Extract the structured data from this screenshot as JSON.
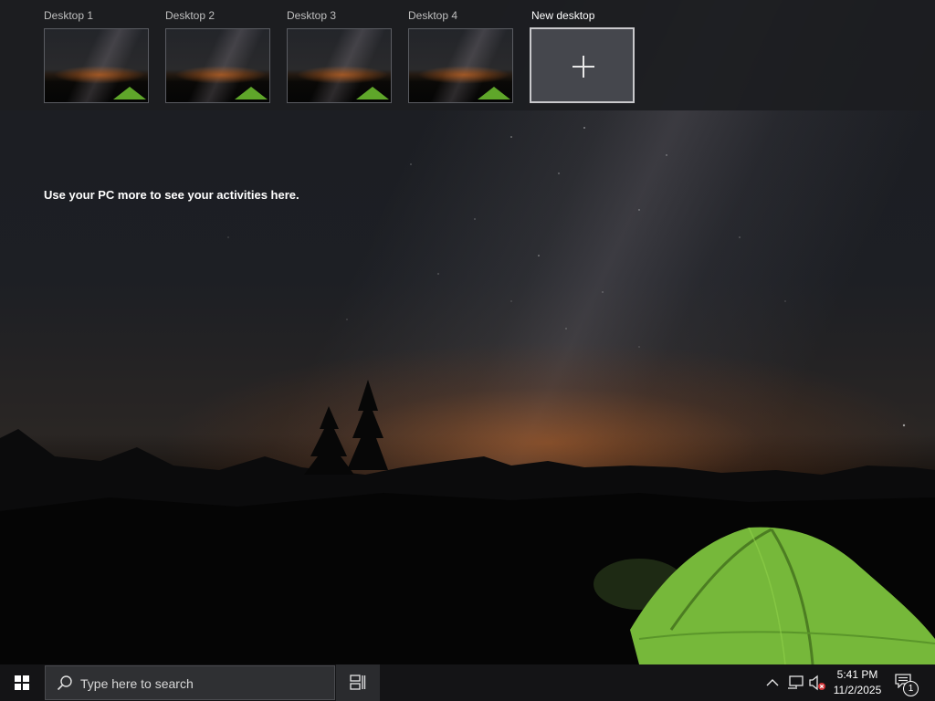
{
  "task_view": {
    "desktops": [
      {
        "label": "Desktop 1"
      },
      {
        "label": "Desktop 2"
      },
      {
        "label": "Desktop 3"
      },
      {
        "label": "Desktop 4"
      }
    ],
    "new_desktop_label": "New desktop",
    "activities_message": "Use your PC more to see your activities here."
  },
  "taskbar": {
    "search_placeholder": "Type here to search",
    "clock": {
      "time": "5:41 PM",
      "date": "11/2/2025"
    },
    "notification_count": "1",
    "icons": {
      "start": "windows-logo-icon",
      "search": "search-icon",
      "task_view": "task-view-icon",
      "chevron": "chevron-up-icon",
      "network": "network-icon",
      "volume": "volume-muted-icon",
      "action_center": "notification-icon"
    }
  },
  "colors": {
    "taskbar_bg": "#141416",
    "strip_bg": "#1c1d21",
    "tent_green": "#7cc43a",
    "horizon_glow": "#be5f1e"
  }
}
